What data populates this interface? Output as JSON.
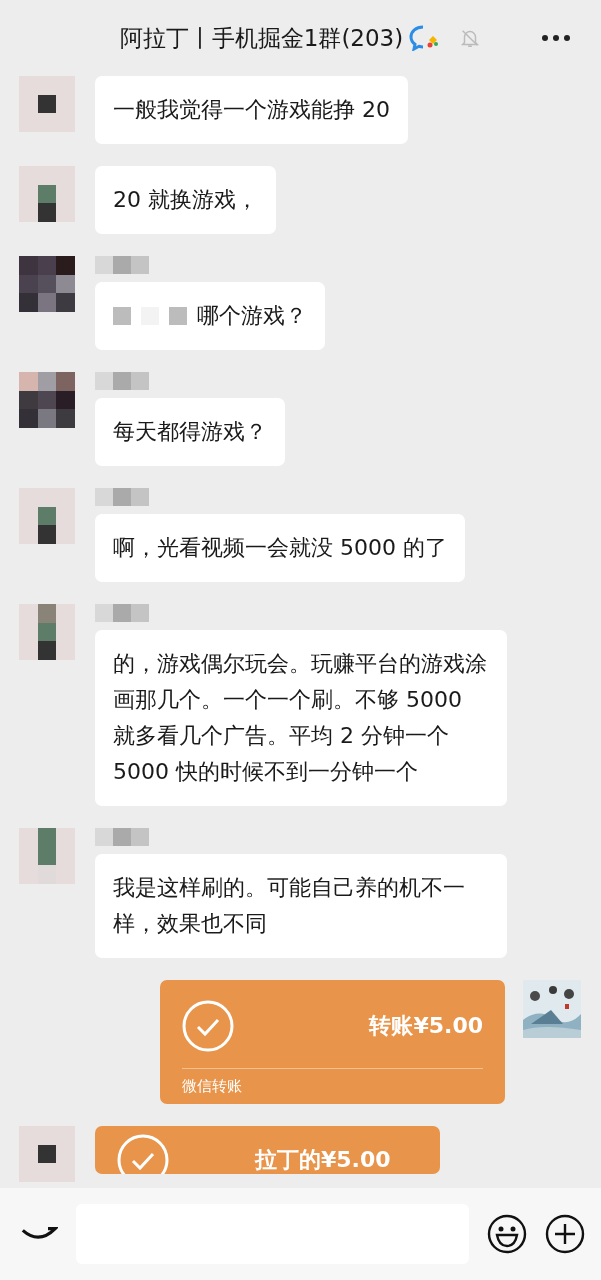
{
  "header": {
    "title": "阿拉丁丨手机掘金1群(203)",
    "muted": true
  },
  "messages": [
    {
      "outgoing": false,
      "kind": "text",
      "show_name": false,
      "text": "一般我觉得一个游戏能挣 20"
    },
    {
      "outgoing": false,
      "kind": "text",
      "show_name": false,
      "text": "20 就换游戏，"
    },
    {
      "outgoing": false,
      "kind": "text",
      "show_name": true,
      "redacted_prefix": true,
      "text": "哪个游戏？"
    },
    {
      "outgoing": false,
      "kind": "text",
      "show_name": true,
      "text": "每天都得游戏？"
    },
    {
      "outgoing": false,
      "kind": "text",
      "show_name": true,
      "text": "啊，光看视频一会就没 5000 的了"
    },
    {
      "outgoing": false,
      "kind": "text",
      "show_name": true,
      "text": "的，游戏偶尔玩会。玩赚平台的游戏涂画那几个。一个一个刷。不够 5000 就多看几个广告。平均 2 分钟一个 5000 快的时候不到一分钟一个"
    },
    {
      "outgoing": false,
      "kind": "text",
      "show_name": true,
      "text": "我是这样刷的。可能自己养的机不一样，效果也不同"
    },
    {
      "outgoing": true,
      "kind": "transfer",
      "show_name": false,
      "amount": "转账¥5.00",
      "footer": "微信转账"
    },
    {
      "outgoing": false,
      "kind": "transfer",
      "show_name": false,
      "amount": "拉丁的¥5.00"
    }
  ]
}
